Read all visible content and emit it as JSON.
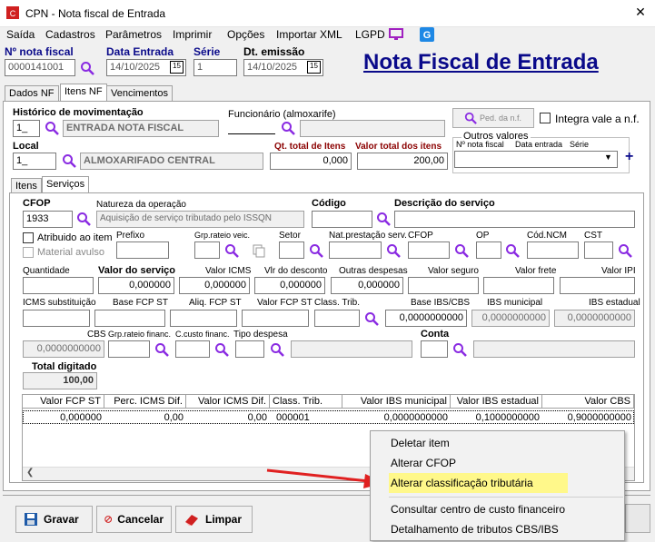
{
  "window": {
    "title": "CPN - Nota fiscal de Entrada"
  },
  "menu": [
    "Saída",
    "Cadastros",
    "Parâmetros",
    "Imprimir",
    "Opções",
    "Importar XML",
    "LGPD"
  ],
  "header": {
    "nf_label": "Nº nota fiscal",
    "nf_value": "0000141001",
    "data_entrada_label": "Data Entrada",
    "data_entrada_value": "14/10/2025",
    "serie_label": "Série",
    "serie_value": "1",
    "dt_emissao_label": "Dt. emissão",
    "dt_emissao_value": "14/10/2025",
    "big_title": "Nota Fiscal de Entrada",
    "cal_text": "15"
  },
  "tabs": [
    "Dados NF",
    "Itens NF",
    "Vencimentos"
  ],
  "top": {
    "historico_label": "Histórico de movimentação",
    "historico_code": "1_",
    "historico_desc": "ENTRADA NOTA FISCAL",
    "funcionario_label": "Funcionário (almoxarife)",
    "ped_label": "Ped. da n.f.",
    "integra_label": "Integra vale a n.f.",
    "local_label": "Local",
    "local_code": "1_",
    "local_desc": "ALMOXARIFADO CENTRAL",
    "qt_total_label": "Qt. total de Itens",
    "qt_total_value": "0,000",
    "valor_total_label": "Valor total dos itens",
    "valor_total_value": "200,00",
    "outros_label": "Outros valores",
    "outros_nf": "Nº nota fiscal",
    "outros_data": "Data entrada",
    "outros_serie": "Série",
    "plus": "+"
  },
  "subtabs": [
    "Itens",
    "Serviços"
  ],
  "servico": {
    "cfop_label": "CFOP",
    "cfop_value": "1933",
    "natureza_label": "Natureza da operação",
    "natureza_value": "Aquisição de serviço tributado pelo ISSQN",
    "codigo_label": "Código",
    "descricao_label": "Descrição do serviço",
    "atribuido_label": "Atribuido ao item",
    "material_label": "Material avulso",
    "prefixo_label": "Prefixo",
    "grp_rateio_label": "Grp.rateio veic.",
    "setor_label": "Setor",
    "nat_prest_label": "Nat.prestação serv.",
    "cfop2_label": "CFOP",
    "op_label": "OP",
    "ncm_label": "Cód.NCM",
    "cst_label": "CST",
    "quantidade_label": "Quantidade",
    "valor_servico_label": "Valor do serviço",
    "valor_icms_label": "Valor ICMS",
    "vlr_desconto_label": "Vlr do desconto",
    "outras_despesas_label": "Outras despesas",
    "valor_seguro_label": "Valor seguro",
    "valor_frete_label": "Valor frete",
    "valor_ipi_label": "Valor IPI",
    "valor_servico_value": "0,000000",
    "valor_icms_value": "0,000000",
    "vlr_desconto_value": "0,000000",
    "outras_despesas_value": "0,000000",
    "icms_subst_label": "ICMS substituição",
    "base_fcp_label": "Base FCP ST",
    "aliq_fcp_label": "Aliq. FCP ST",
    "valor_fcp_label": "Valor FCP ST",
    "class_trib_label": "Class. Trib.",
    "base_ibs_label": "Base IBS/CBS",
    "ibs_mun_label": "IBS municipal",
    "ibs_est_label": "IBS estadual",
    "base_ibs_value": "0,0000000000",
    "ibs_mun_value": "0,0000000000",
    "ibs_est_value": "0,0000000000",
    "cbs_label": "CBS",
    "cbs_value": "0,0000000000",
    "grp_fin_label": "Grp.rateio financ.",
    "ccusto_label": "C.custo financ.",
    "tipo_desp_label": "Tipo despesa",
    "conta_label": "Conta",
    "total_digitado_label": "Total digitado",
    "total_digitado_value": "100,00"
  },
  "grid": {
    "headers": [
      "Valor FCP ST",
      "Perc. ICMS Dif.",
      "Valor ICMS Dif.",
      "Class. Trib.",
      "Valor IBS municipal",
      "Valor IBS estadual",
      "Valor CBS"
    ],
    "row": [
      "0,000000",
      "0,00",
      "0,00",
      "000001",
      "0,0000000000",
      "0,1000000000",
      "0,9000000000"
    ]
  },
  "buttons": {
    "gravar": "Gravar",
    "cancelar": "Cancelar",
    "limpar": "Limpar"
  },
  "context_menu": [
    "Deletar item",
    "Alterar CFOP",
    "Alterar classificação tributária",
    "Consultar centro de custo financeiro",
    "Detalhamento de tributos CBS/IBS"
  ],
  "colors": {
    "purple": "#8a2be2",
    "title_blue": "#0a0a8a",
    "dark_red": "#8b0000",
    "highlight": "#fff88a",
    "arrow": "#e02020"
  }
}
